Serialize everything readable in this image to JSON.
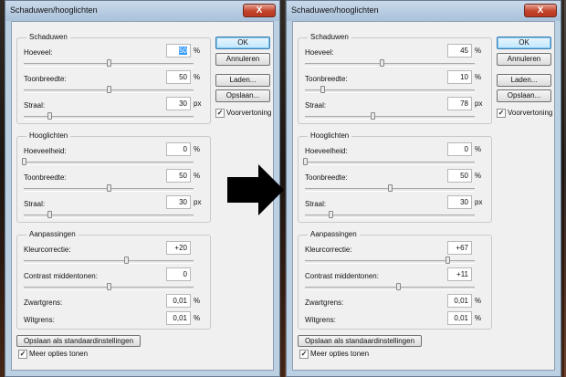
{
  "left": {
    "title": "Schaduwen/hooglichten",
    "close_label": "X",
    "ok_label": "OK",
    "cancel_label": "Annuleren",
    "load_label": "Laden...",
    "save_label": "Opslaan...",
    "preview_label": "Voorvertoning",
    "preview_checked": true,
    "shadows": {
      "legend": "Schaduwen",
      "amount": {
        "label": "Hoeveel:",
        "value": "50",
        "unit": "%",
        "level": 0.5
      },
      "tonal": {
        "label": "Toonbreedte:",
        "value": "50",
        "unit": "%",
        "level": 0.5
      },
      "radius": {
        "label": "Straal:",
        "value": "30",
        "unit": "px",
        "level": 0.15
      }
    },
    "highlights": {
      "legend": "Hooglichten",
      "amount": {
        "label": "Hoeveelheid:",
        "value": "0",
        "unit": "%",
        "level": 0.0
      },
      "tonal": {
        "label": "Toonbreedte:",
        "value": "50",
        "unit": "%",
        "level": 0.5
      },
      "radius": {
        "label": "Straal:",
        "value": "30",
        "unit": "px",
        "level": 0.15
      }
    },
    "adjust": {
      "legend": "Aanpassingen",
      "color": {
        "label": "Kleurcorrectie:",
        "value": "+20",
        "level": 0.6
      },
      "contrast": {
        "label": "Contrast middentonen:",
        "value": "0",
        "level": 0.5
      },
      "black": {
        "label": "Zwartgrens:",
        "value": "0,01",
        "unit": "%"
      },
      "white": {
        "label": "Witgrens:",
        "value": "0,01",
        "unit": "%"
      }
    },
    "save_defaults_label": "Opslaan als standaardinstellingen",
    "more_options_label": "Meer opties tonen",
    "more_options_checked": true
  },
  "right": {
    "title": "Schaduwen/hooglichten",
    "close_label": "X",
    "ok_label": "OK",
    "cancel_label": "Annuleren",
    "load_label": "Laden...",
    "save_label": "Opslaan...",
    "preview_label": "Voorvertoning",
    "preview_checked": true,
    "shadows": {
      "legend": "Schaduwen",
      "amount": {
        "label": "Hoeveel:",
        "value": "45",
        "unit": "%",
        "level": 0.45
      },
      "tonal": {
        "label": "Toonbreedte:",
        "value": "10",
        "unit": "%",
        "level": 0.1
      },
      "radius": {
        "label": "Straal:",
        "value": "78",
        "unit": "px",
        "level": 0.4
      }
    },
    "highlights": {
      "legend": "Hooglichten",
      "amount": {
        "label": "Hoeveelheid:",
        "value": "0",
        "unit": "%",
        "level": 0.0
      },
      "tonal": {
        "label": "Toonbreedte:",
        "value": "50",
        "unit": "%",
        "level": 0.5
      },
      "radius": {
        "label": "Straal:",
        "value": "30",
        "unit": "px",
        "level": 0.15
      }
    },
    "adjust": {
      "legend": "Aanpassingen",
      "color": {
        "label": "Kleurcorrectie:",
        "value": "+67",
        "level": 0.84
      },
      "contrast": {
        "label": "Contrast middentonen:",
        "value": "+11",
        "level": 0.55
      },
      "black": {
        "label": "Zwartgrens:",
        "value": "0,01",
        "unit": "%"
      },
      "white": {
        "label": "Witgrens:",
        "value": "0,01",
        "unit": "%"
      }
    },
    "save_defaults_label": "Opslaan als standaardinstellingen",
    "more_options_label": "Meer opties tonen",
    "more_options_checked": true
  },
  "arrow_icon": "right-arrow-icon"
}
